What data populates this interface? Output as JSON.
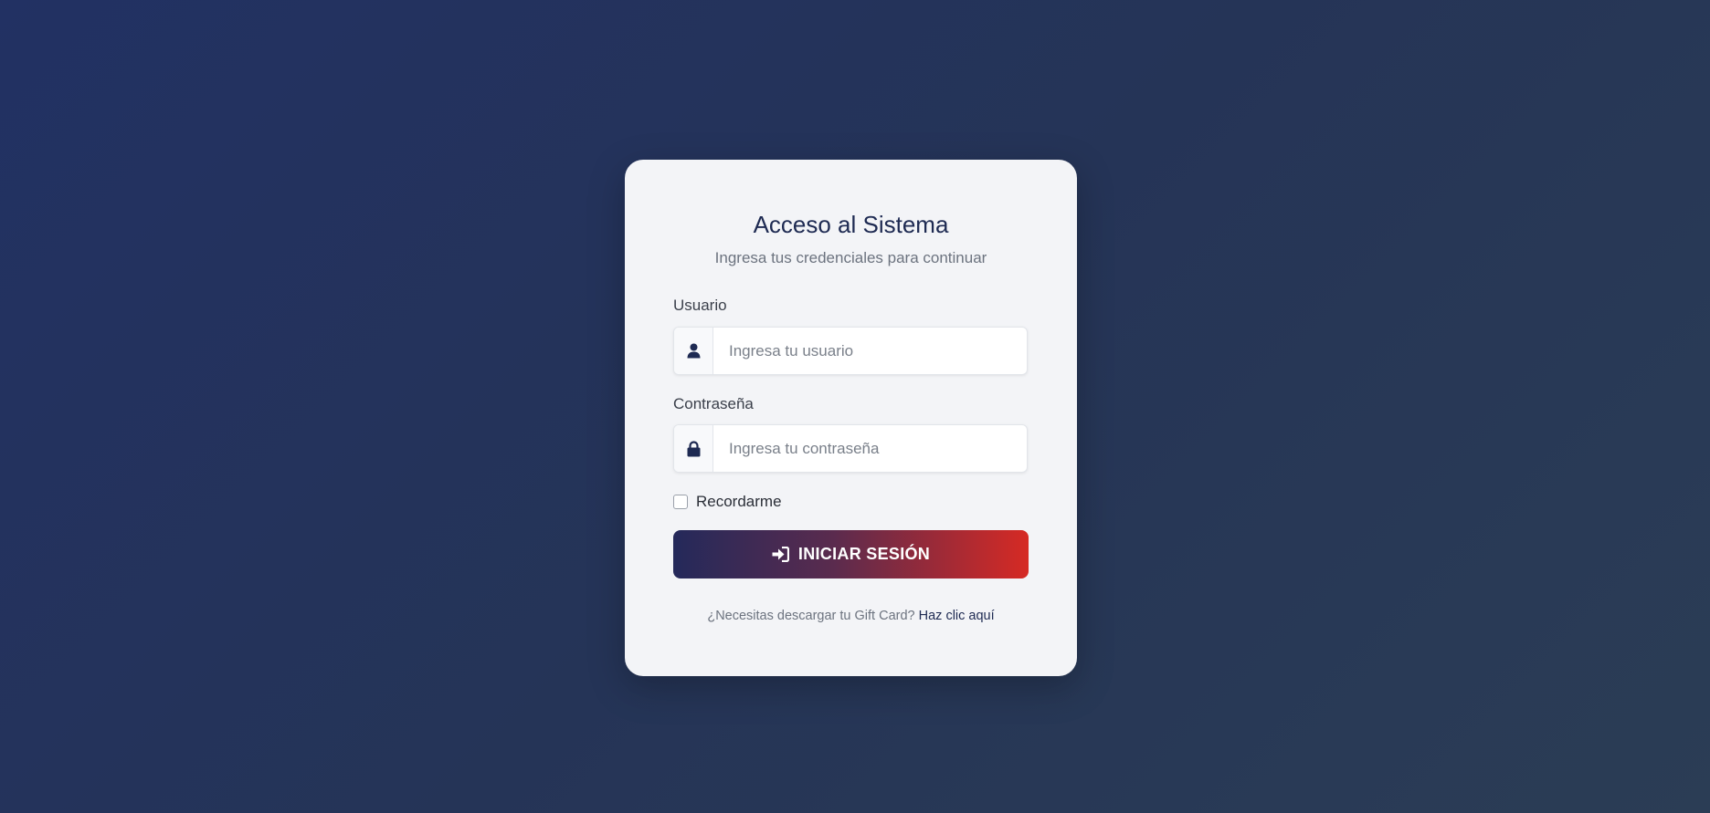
{
  "login": {
    "title": "Acceso al Sistema",
    "subtitle": "Ingresa tus credenciales para continuar",
    "username": {
      "label": "Usuario",
      "placeholder": "Ingresa tu usuario",
      "value": "",
      "icon": "user-icon"
    },
    "password": {
      "label": "Contraseña",
      "placeholder": "Ingresa tu contraseña",
      "value": "",
      "icon": "lock-icon"
    },
    "remember": {
      "label": "Recordarme",
      "checked": false
    },
    "submit": {
      "label": "INICIAR SESIÓN",
      "icon": "sign-in-icon"
    },
    "footer": {
      "text": "¿Necesitas descargar tu Gift Card?",
      "link": "Haz clic aquí"
    }
  },
  "colors": {
    "background": "#243359",
    "card": "#f3f4f7",
    "title": "#1e2a52",
    "button_start": "#24295a",
    "button_end": "#d62a24"
  }
}
